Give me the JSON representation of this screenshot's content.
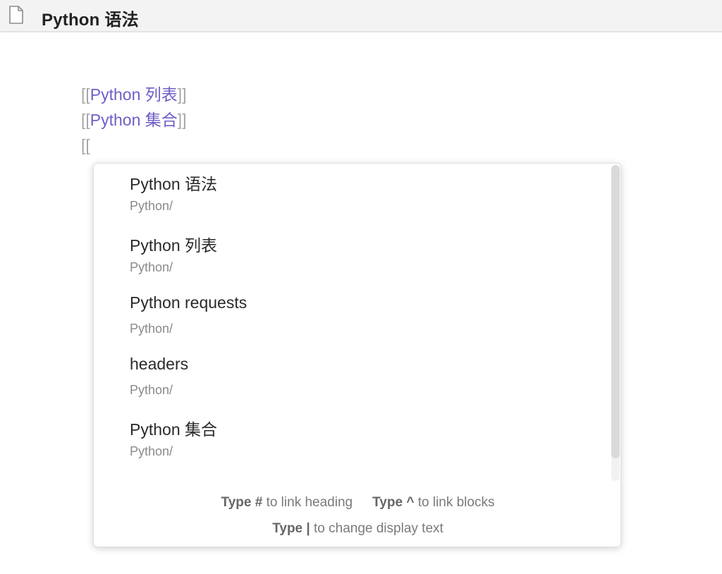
{
  "title_bar": {
    "icon": "document-icon",
    "title": "Python 语法"
  },
  "editor": {
    "lines": [
      {
        "open": "[[",
        "link": "Python 列表",
        "close": "]]"
      },
      {
        "open": "[[",
        "link": "Python 集合",
        "close": "]]"
      },
      {
        "open": "[[",
        "link": "",
        "close": ""
      }
    ]
  },
  "suggestions": [
    {
      "title": "Python 语法",
      "path": "Python/"
    },
    {
      "title": "Python 列表",
      "path": "Python/"
    },
    {
      "title": "Python requests",
      "path": "Python/"
    },
    {
      "title": "headers",
      "path": "Python/"
    },
    {
      "title": "Python 集合",
      "path": "Python/"
    }
  ],
  "hints": {
    "heading": {
      "key": "Type #",
      "text": "to link heading"
    },
    "blocks": {
      "key": "Type ^",
      "text": "to link blocks"
    },
    "display": {
      "key": "Type |",
      "text": "to change display text"
    }
  }
}
